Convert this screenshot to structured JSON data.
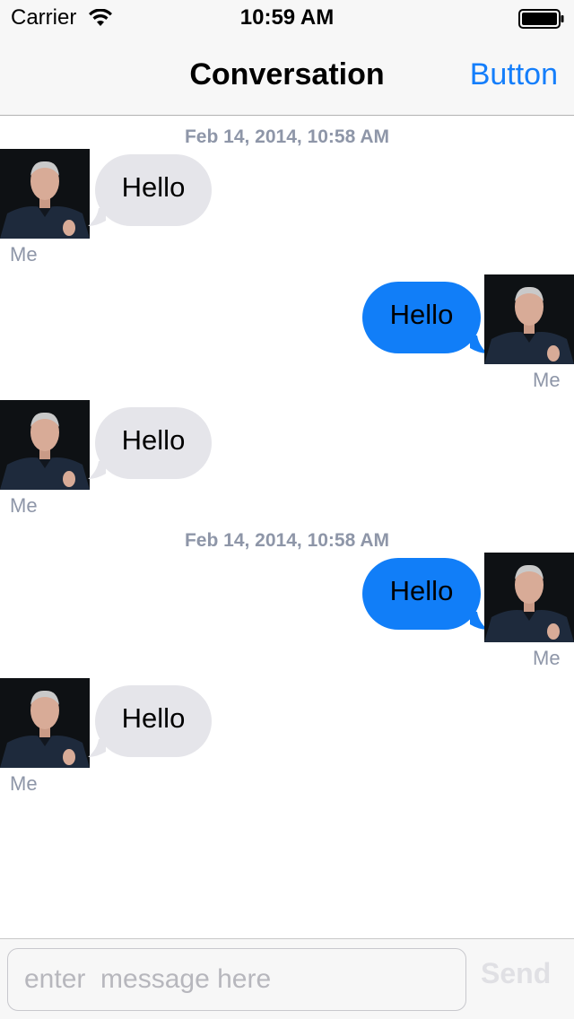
{
  "status_bar": {
    "carrier": "Carrier",
    "time": "10:59 AM"
  },
  "nav": {
    "title": "Conversation",
    "right_button": "Button"
  },
  "colors": {
    "accent": "#147efb",
    "outgoing_bubble": "#117ef8",
    "incoming_bubble": "#e5e5ea",
    "meta_text": "#8e96a8"
  },
  "timestamps": [
    "Feb 14, 2014, 10:58 AM",
    "Feb 14, 2014, 10:58 AM"
  ],
  "messages": [
    {
      "direction": "incoming",
      "text": "Hello",
      "sender": "Me",
      "avatar": "person-photo"
    },
    {
      "direction": "outgoing",
      "text": "Hello",
      "sender": "Me",
      "avatar": "person-photo"
    },
    {
      "direction": "incoming",
      "text": "Hello",
      "sender": "Me",
      "avatar": "person-photo"
    },
    {
      "direction": "outgoing",
      "text": "Hello",
      "sender": "Me",
      "avatar": "person-photo"
    },
    {
      "direction": "incoming",
      "text": "Hello",
      "sender": "Me",
      "avatar": "person-photo"
    }
  ],
  "composer": {
    "placeholder": "enter  message here",
    "value": "",
    "send_label": "Send"
  }
}
